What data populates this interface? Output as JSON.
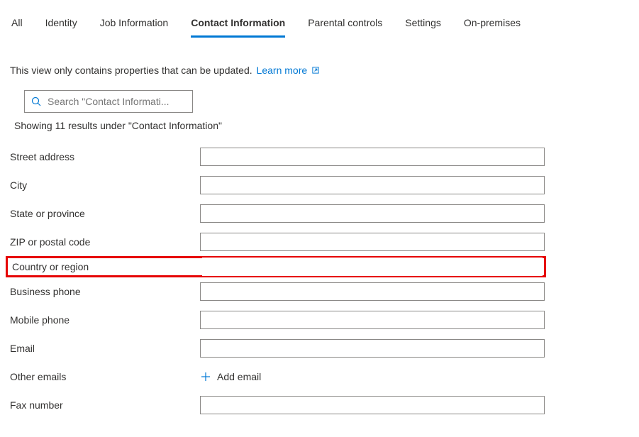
{
  "tabs": {
    "all": "All",
    "identity": "Identity",
    "job": "Job Information",
    "contact": "Contact Information",
    "parental": "Parental controls",
    "settings": "Settings",
    "onprem": "On-premises"
  },
  "info": {
    "text": "This view only contains properties that can be updated.",
    "learn_more": "Learn more"
  },
  "search": {
    "placeholder": "Search \"Contact Informati..."
  },
  "results_line": "Showing 11 results under \"Contact Information\"",
  "fields": {
    "street": "Street address",
    "city": "City",
    "state": "State or province",
    "zip": "ZIP or postal code",
    "country": "Country or region",
    "business_phone": "Business phone",
    "mobile_phone": "Mobile phone",
    "email": "Email",
    "other_emails": "Other emails",
    "fax": "Fax number"
  },
  "actions": {
    "add_email": "Add email"
  },
  "values": {
    "street": "",
    "city": "",
    "state": "",
    "zip": "",
    "country": "",
    "business_phone": "",
    "mobile_phone": "",
    "email": "",
    "fax": ""
  },
  "colors": {
    "accent": "#0078d4",
    "highlight_border": "#e60000"
  }
}
